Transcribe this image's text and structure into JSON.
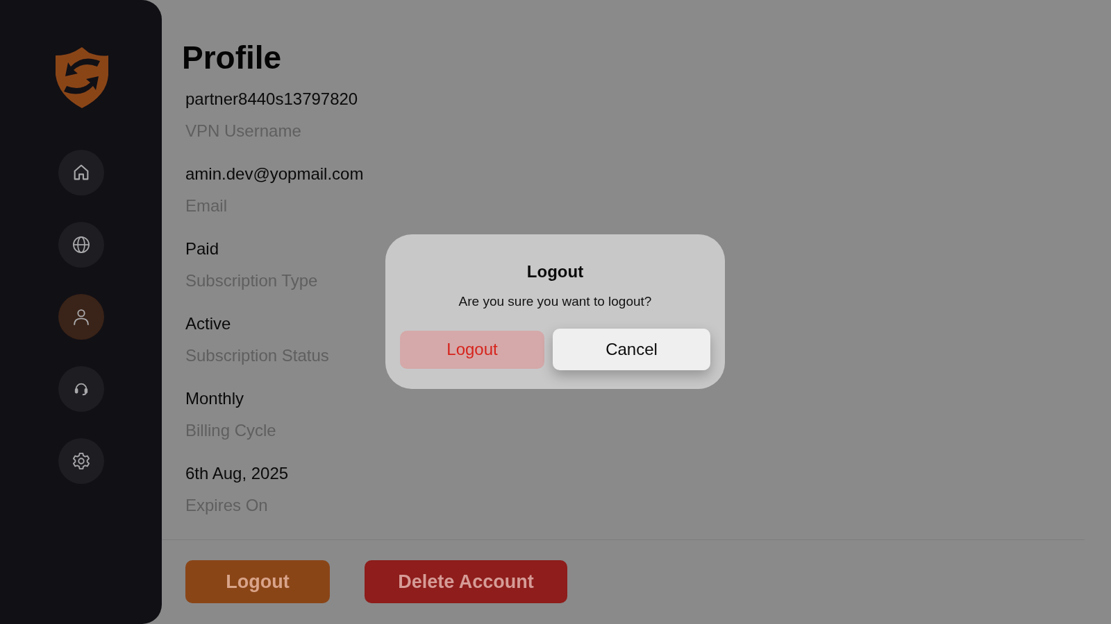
{
  "sidebar": {
    "items": [
      {
        "kind": "home",
        "selected": false
      },
      {
        "kind": "globe",
        "selected": false
      },
      {
        "kind": "person",
        "selected": true
      },
      {
        "kind": "headset",
        "selected": false
      },
      {
        "kind": "gear",
        "selected": false
      }
    ]
  },
  "profile": {
    "title": "Profile",
    "fields": [
      {
        "value": "partner8440s13797820",
        "label": "VPN Username"
      },
      {
        "value": "amin.dev@yopmail.com",
        "label": "Email"
      },
      {
        "value": "Paid",
        "label": "Subscription Type"
      },
      {
        "value": "Active",
        "label": "Subscription Status"
      },
      {
        "value": "Monthly",
        "label": "Billing Cycle"
      },
      {
        "value": "6th Aug, 2025",
        "label": "Expires On"
      }
    ]
  },
  "actions": [
    {
      "label": "Logout",
      "kind": "primary"
    },
    {
      "label": "Delete Account",
      "kind": "danger"
    }
  ],
  "dialog": {
    "title": "Logout",
    "message": "Are you sure you want to logout?",
    "buttons": [
      {
        "label": "Logout",
        "kind": "destructive"
      },
      {
        "label": "Cancel",
        "kind": "cancel"
      }
    ]
  }
}
